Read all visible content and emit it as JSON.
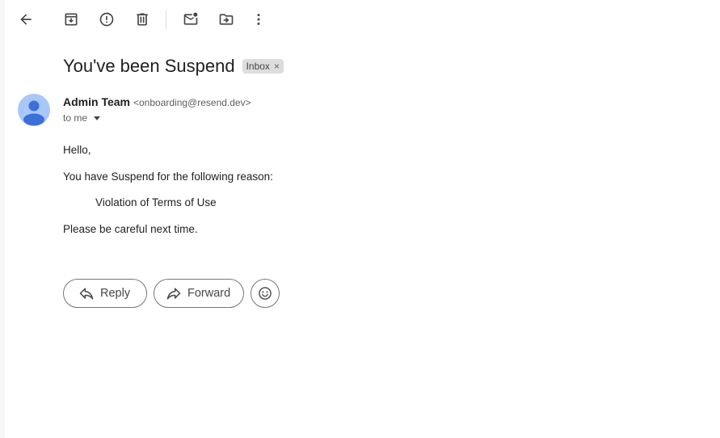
{
  "toolbar": {
    "icons": [
      "back-arrow-icon",
      "archive-icon",
      "report-spam-icon",
      "delete-icon",
      "mark-unread-icon",
      "move-to-icon",
      "more-vert-icon"
    ]
  },
  "email": {
    "subject": "You've been Suspend",
    "label": "Inbox",
    "label_remove": "×",
    "sender_name": "Admin Team",
    "sender_email": "<onboarding@resend.dev>",
    "recipient": "to me",
    "body": {
      "greeting": "Hello,",
      "line1": "You have Suspend for the following reason:",
      "reason": "Violation of Terms of Use",
      "closing": "Please be careful next time."
    }
  },
  "actions": {
    "reply_label": "Reply",
    "forward_label": "Forward",
    "emoji_icon": "smiley-icon"
  },
  "colors": {
    "avatar_bg": "#a8c7fa",
    "avatar_fg": "#3c6fd8",
    "chip_bg": "#dddddd"
  }
}
